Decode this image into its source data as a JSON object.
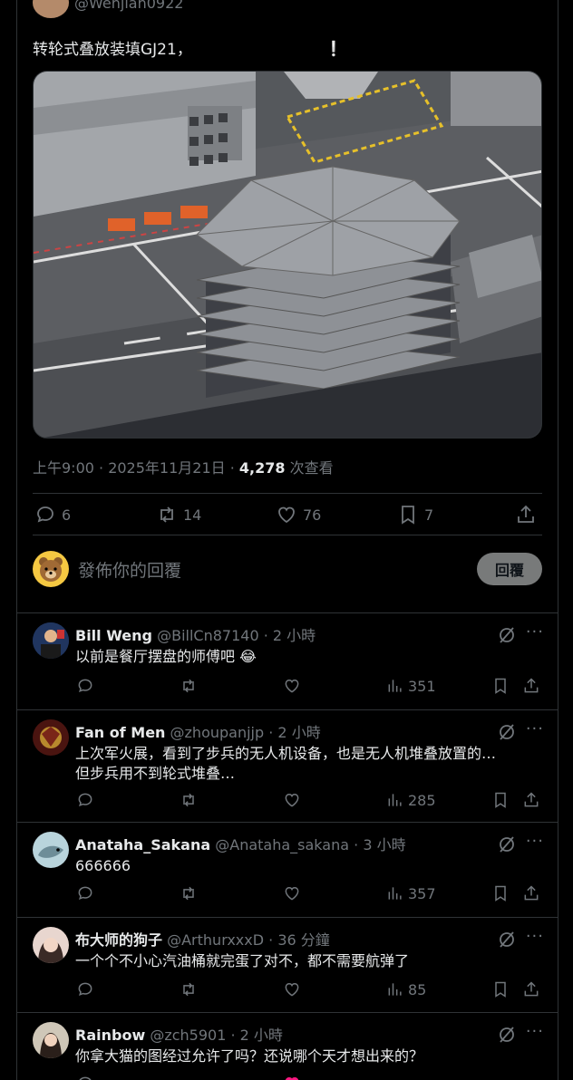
{
  "tweet": {
    "author_handle": "@Wenjian0922",
    "text": "转轮式叠放装填GJ21，",
    "time": "上午9:00 · 2025年11月21日 · ",
    "views_count": "4,278",
    "views_label": " 次查看",
    "stats": {
      "replies": "6",
      "retweets": "14",
      "likes": "76",
      "bookmarks": "7"
    }
  },
  "compose": {
    "placeholder": "發佈你的回覆",
    "button": "回覆"
  },
  "replies": [
    {
      "name": "Bill Weng",
      "handle": "@BillCn87140",
      "time": "· 2 小時",
      "text": "以前是餐厅摆盘的师傅吧 😂",
      "views": "351"
    },
    {
      "name": "Fan of Men",
      "handle": "@zhoupanjjp",
      "time": "· 2 小時",
      "text": "上次军火展，看到了步兵的无人机设备，也是无人机堆叠放置的…",
      "text2": "但步兵用不到轮式堆叠…",
      "views": "285"
    },
    {
      "name": "Anataha_Sakana",
      "handle": "@Anataha_sakana",
      "time": "· 3 小時",
      "text": "666666",
      "views": "357"
    },
    {
      "name": "布大师的狗子",
      "handle": "@ArthurxxxD",
      "time": "· 36 分鐘",
      "text": "一个个不小心汽油桶就完蛋了对不，都不需要航弹了",
      "views": "85"
    },
    {
      "name": "Rainbow",
      "handle": "@zch5901",
      "time": "· 2 小時",
      "text": "你拿大猫的图经过允许了吗？还说哪个天才想出来的？",
      "views": ""
    }
  ],
  "colors": {
    "background": "#000000",
    "text": "#e7e9ea",
    "muted": "#71767b",
    "border": "#2f3336"
  }
}
